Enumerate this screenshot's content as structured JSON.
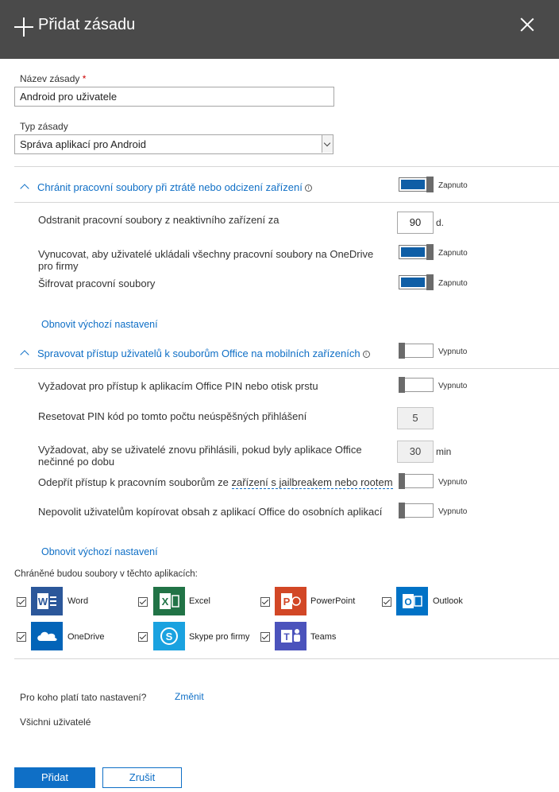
{
  "header": {
    "title": "Přidat zásadu"
  },
  "policy_name": {
    "label": "Název zásady",
    "required_mark": "*",
    "value": "Android pro uživatele"
  },
  "policy_type": {
    "label": "Typ zásady",
    "value": "Správa aplikací pro Android"
  },
  "section_protect": {
    "title": "Chránit pracovní soubory při ztrátě nebo odcizení zařízení",
    "info_glyph": "i",
    "toggle_state": "Zapnuto",
    "rows": {
      "wipe": {
        "text": "Odstranit pracovní soubory z neaktivního zařízení za",
        "value": "90",
        "unit": "d."
      },
      "onedrive": {
        "text": "Vynucovat, aby uživatelé ukládali všechny pracovní soubory na OneDrive pro firmy",
        "state": "Zapnuto"
      },
      "encrypt": {
        "text": "Šifrovat pracovní soubory",
        "state": "Zapnuto"
      }
    },
    "reset_link": "Obnovit výchozí nastavení"
  },
  "section_access": {
    "title": "Spravovat přístup uživatelů k souborům Office na mobilních zařízeních",
    "info_glyph": "i",
    "toggle_state": "Vypnuto",
    "rows": {
      "pin": {
        "text": "Vyžadovat pro přístup k aplikacím Office PIN nebo otisk prstu",
        "state": "Vypnuto"
      },
      "reset_pin": {
        "text": "Resetovat PIN kód po tomto počtu neúspěšných přihlášení",
        "value": "5"
      },
      "relogin": {
        "text": "Vyžadovat, aby se uživatelé znovu přihlásili, pokud byly aplikace Office nečinné po dobu",
        "value": "30",
        "unit": "min"
      },
      "jailbreak": {
        "text_prefix": "Odepřít přístup k pracovním souborům ze ",
        "text_link": "zařízení s jailbreakem nebo rootem",
        "state": "Vypnuto"
      },
      "copy": {
        "text": "Nepovolit uživatelům kopírovat obsah z aplikací Office do osobních aplikací",
        "state": "Vypnuto"
      }
    },
    "reset_link": "Obnovit výchozí nastavení"
  },
  "apps": {
    "label": "Chráněné budou soubory v těchto aplikacích:",
    "items": [
      {
        "name": "Word",
        "icon": "word-icon",
        "letter": "W",
        "color": "#2b579a"
      },
      {
        "name": "Excel",
        "icon": "excel-icon",
        "letter": "X",
        "color": "#217346"
      },
      {
        "name": "PowerPoint",
        "icon": "powerpoint-icon",
        "letter": "P",
        "color": "#d24726"
      },
      {
        "name": "Outlook",
        "icon": "outlook-icon",
        "letter": "O",
        "color": "#0072c6"
      },
      {
        "name": "OneDrive",
        "icon": "onedrive-icon",
        "letter": "",
        "color": "#0364b8"
      },
      {
        "name": "Skype pro firmy",
        "icon": "skype-icon",
        "letter": "S",
        "color": "#1aa2e0"
      },
      {
        "name": "Teams",
        "icon": "teams-icon",
        "letter": "T",
        "color": "#4b53bc"
      }
    ]
  },
  "assignment": {
    "question": "Pro koho platí tato nastavení?",
    "change_link": "Změnit",
    "value": "Všichni uživatelé"
  },
  "footer": {
    "add_label": "Přidat",
    "cancel_label": "Zrušit"
  }
}
